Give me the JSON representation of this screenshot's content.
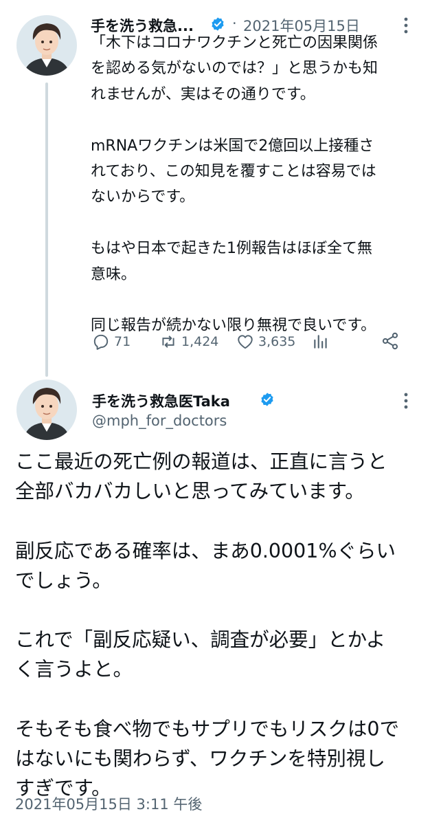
{
  "tweet1": {
    "author_name": "手を洗う救急...",
    "separator": "·",
    "date": "2021年05月15日",
    "body": "「木下はコロナワクチンと死亡の因果関係\nを認める気がないのでは？」と思うかも知\nれませんが、実はその通りです。\n\nmRNAワクチンは米国で2億回以上接種さ\nれており、この知見を覆すことは容易では\nないからです。\n\nもはや日本で起きた1例報告はほぼ全て無\n意味。\n\n同じ報告が続かない限り無視で良いです。",
    "reply_count": "71",
    "retweet_count": "1,424",
    "like_count": "3,635"
  },
  "tweet2": {
    "author_name": "手を洗う救急医Taka",
    "handle": "@mph_for_doctors",
    "body": "ここ最近の死亡例の報道は、正直に言うと\n全部バカバカしいと思ってみています。\n\n副反応である確率は、まあ0.0001%ぐらい\nでしょう。\n\nこれで「副反応疑い、調査が必要」とかよ\nく言うよと。\n\nそもそも食べ物でもサプリでもリスクは0で\nはないにも関わらず、ワクチンを特別視し\nすぎです。",
    "timestamp": "2021年05月15日 3:11 午後"
  },
  "colors": {
    "text": "#0f1419",
    "secondary": "#536471",
    "verified": "#1d9bf0",
    "thread_line": "#cfd9de"
  },
  "icons": [
    "avatar",
    "verified-badge-icon",
    "more-icon",
    "reply-icon",
    "retweet-icon",
    "like-icon",
    "analytics-icon",
    "share-icon"
  ]
}
